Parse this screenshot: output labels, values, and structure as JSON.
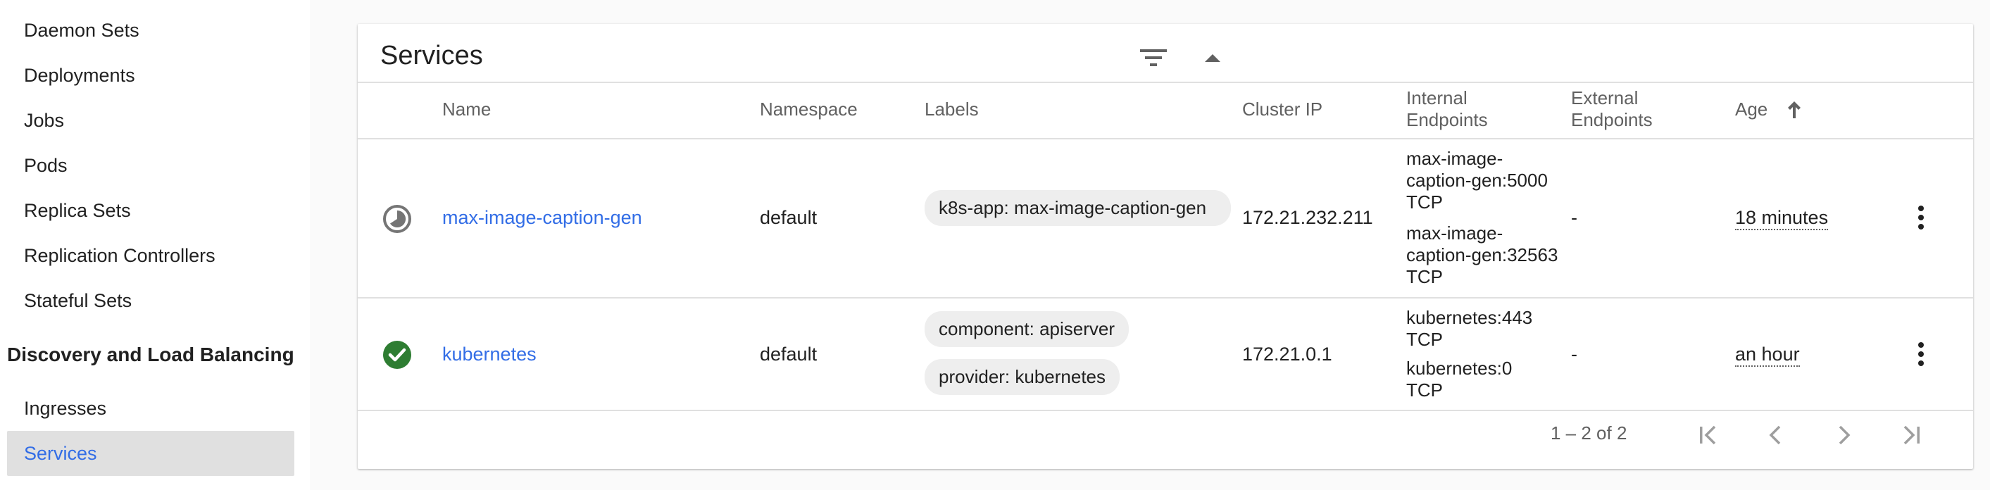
{
  "sidebar": {
    "workloads_items": [
      "Daemon Sets",
      "Deployments",
      "Jobs",
      "Pods",
      "Replica Sets",
      "Replication Controllers",
      "Stateful Sets"
    ],
    "section_title": "Discovery and Load Balancing",
    "discovery_items": [
      "Ingresses",
      "Services"
    ],
    "active_item": "Services"
  },
  "card": {
    "title": "Services",
    "columns": {
      "name": "Name",
      "namespace": "Namespace",
      "labels": "Labels",
      "cluster_ip": "Cluster IP",
      "internal_endpoints": "Internal Endpoints",
      "external_endpoints": "External Endpoints",
      "age": "Age"
    },
    "rows": [
      {
        "status": "pending",
        "name": "max-image-caption-gen",
        "namespace": "default",
        "labels": [
          "k8s-app: max-image-caption-gen"
        ],
        "cluster_ip": "172.21.232.211",
        "internal_endpoints": [
          "max-image-caption-gen:5000 TCP",
          "max-image-caption-gen:32563 TCP"
        ],
        "external_endpoints": "-",
        "age": "18 minutes"
      },
      {
        "status": "success",
        "name": "kubernetes",
        "namespace": "default",
        "labels": [
          "component: apiserver",
          "provider: kubernetes"
        ],
        "cluster_ip": "172.21.0.1",
        "internal_endpoints": [
          "kubernetes:443 TCP",
          "kubernetes:0 TCP"
        ],
        "external_endpoints": "-",
        "age": "an hour"
      }
    ],
    "pagination": "1 – 2 of 2"
  },
  "colors": {
    "link": "#326de6",
    "success": "#2e7d32",
    "pending": "#757575",
    "active_bg": "#e0e0e0"
  }
}
